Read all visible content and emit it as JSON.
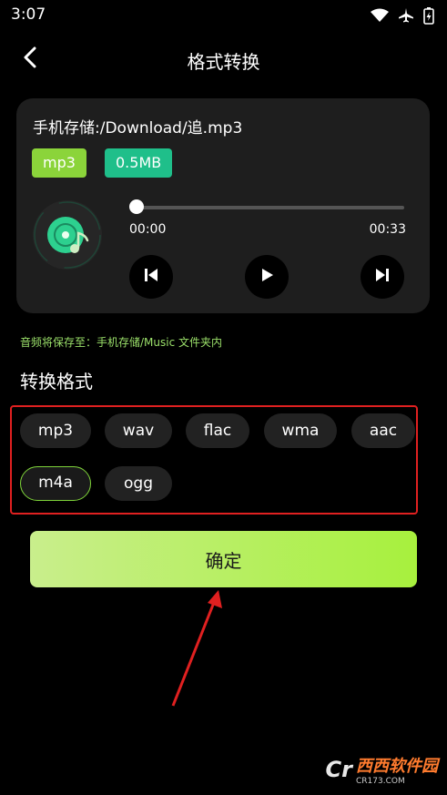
{
  "status_bar": {
    "time": "3:07"
  },
  "header": {
    "title": "格式转换"
  },
  "file": {
    "path": "手机存储:/Download/追.mp3",
    "format": "mp3",
    "size": "0.5MB"
  },
  "player": {
    "current_time": "00:00",
    "total_time": "00:33",
    "progress": 0
  },
  "save_note": "音频将保存至：手机存储/Music 文件夹内",
  "section_title": "转换格式",
  "formats": [
    "mp3",
    "wav",
    "flac",
    "wma",
    "aac",
    "m4a",
    "ogg"
  ],
  "selected_format": "m4a",
  "confirm_label": "确定",
  "watermark": {
    "brand": "Cr",
    "name": "西西软件园",
    "sub": "CR173.COM"
  },
  "colors": {
    "accent_green": "#8bd43a",
    "size_badge": "#1fbf8a",
    "highlight_border": "#e02020"
  }
}
